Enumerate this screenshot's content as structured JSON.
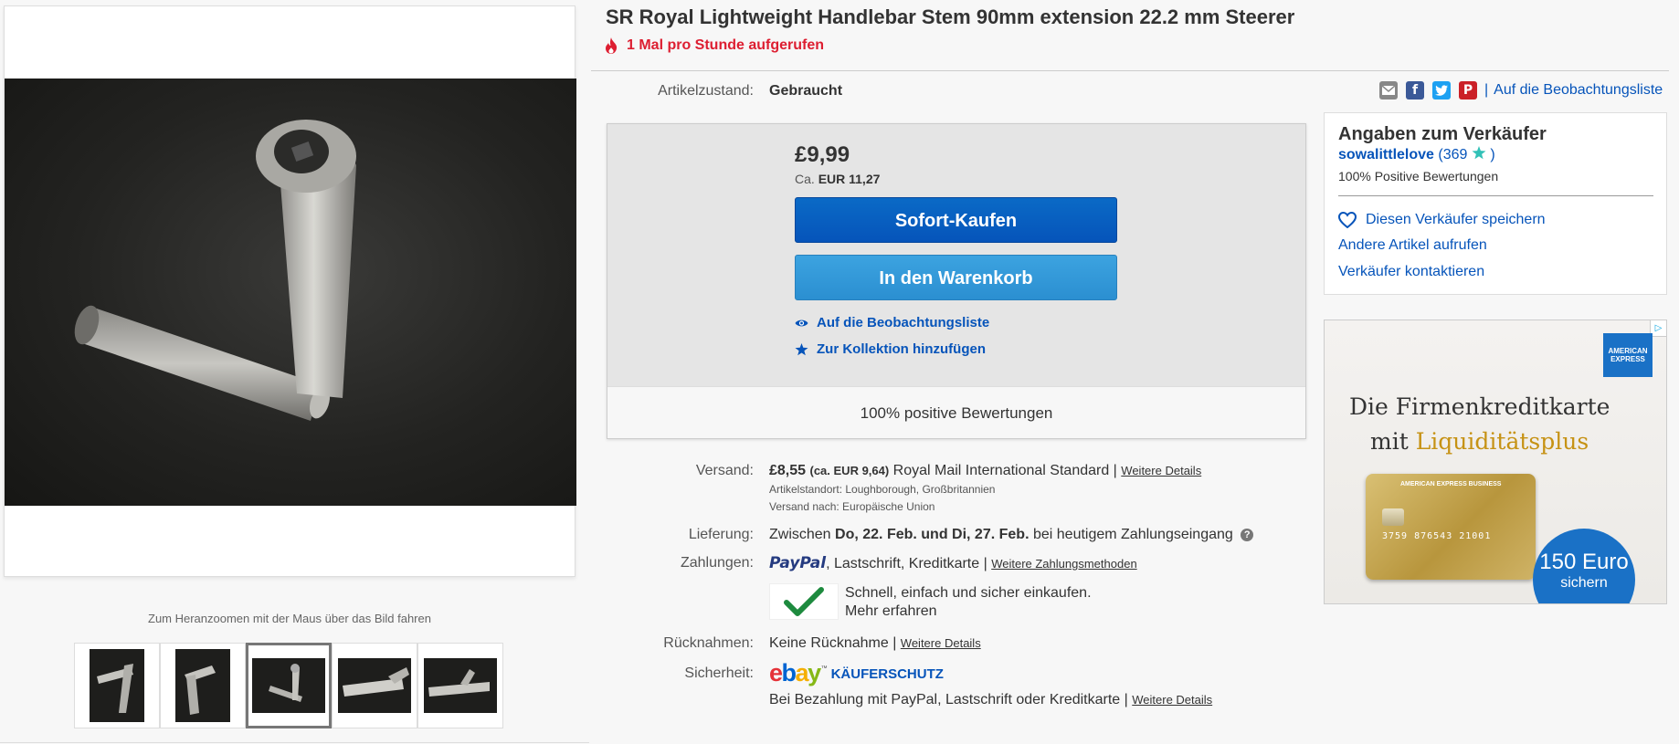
{
  "title": "SR Royal Lightweight Handlebar Stem 90mm extension 22.2 mm Steerer",
  "views": "1 Mal pro Stunde aufgerufen",
  "gallery": {
    "zoom_hint": "Zum Heranzoomen mit der Maus über das Bild fahren",
    "thumb_count": 5,
    "active_thumb": 3
  },
  "condition": {
    "label": "Artikelzustand:",
    "value": "Gebraucht"
  },
  "share": {
    "icons": [
      "email-icon",
      "facebook-icon",
      "twitter-icon",
      "pinterest-icon"
    ],
    "watch_label": "Auf die Beobachtungsliste"
  },
  "buybox": {
    "price": "£9,99",
    "approx_prefix": "Ca.",
    "approx_value": "EUR 11,27",
    "buy_now": "Sofort-Kaufen",
    "add_to_cart": "In den Warenkorb",
    "watch": "Auf die Beobachtungsliste",
    "collection": "Zur Kollektion hinzufügen",
    "feedback": "100% positive Bewertungen"
  },
  "shipping": {
    "label": "Versand:",
    "price": "£8,55",
    "approx": "(ca. EUR 9,64)",
    "service": "Royal Mail International Standard |",
    "details_link": "Weitere Details",
    "location": "Artikelstandort:  Loughborough, Großbritannien",
    "ships_to": "Versand nach:  Europäische Union"
  },
  "delivery": {
    "label": "Lieferung:",
    "prefix": "Zwischen",
    "dates": "Do, 22. Feb. und Di, 27. Feb.",
    "suffix": "bei heutigem Zahlungseingang"
  },
  "payments": {
    "label": "Zahlungen:",
    "paypal": "PayPal",
    "methods": ",  Lastschrift,  Kreditkarte  |",
    "more_link": "Weitere Zahlungsmethoden",
    "promo_line1": "Schnell, einfach und sicher einkaufen.",
    "promo_line2": "Mehr erfahren"
  },
  "returns": {
    "label": "Rücknahmen:",
    "value": "Keine Rücknahme |",
    "details_link": "Weitere Details"
  },
  "security": {
    "label": "Sicherheit:",
    "protection": "KÄUFERSCHUTZ",
    "text": "Bei Bezahlung mit PayPal, Lastschrift oder Kreditkarte |",
    "details_link": "Weitere Details"
  },
  "seller": {
    "heading": "Angaben zum Verkäufer",
    "name": "sowalittlelove",
    "score": "(369",
    "score_close": ")",
    "positive": "100% Positive Bewertungen",
    "save": "Diesen Verkäufer speichern",
    "other_items": "Andere Artikel aufrufen",
    "contact": "Verkäufer kontaktieren"
  },
  "ad": {
    "line1": "Die Firmenkreditkarte",
    "line2_prefix": "mit",
    "line2_highlight": "Liquiditätsplus",
    "brand": "AMERICAN EXPRESS",
    "card_text": "AMERICAN EXPRESS BUSINESS",
    "card_number": "3759 876543 21001",
    "badge_amount": "150 Euro",
    "badge_word": "sichern"
  },
  "colors": {
    "link": "#0654ba",
    "buy_button": "#0654ba",
    "cart_button": "#3498db",
    "alert": "#dd1e31"
  }
}
